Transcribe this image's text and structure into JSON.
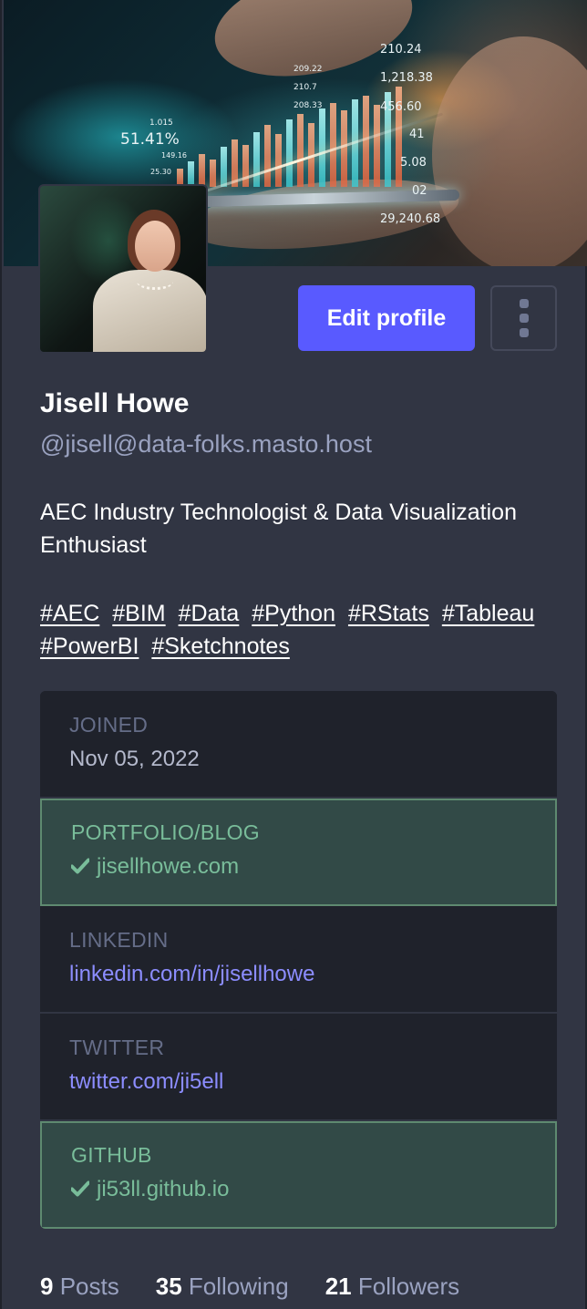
{
  "banner": {
    "numbers": [
      "210.24",
      "1,218.38",
      "456.60",
      "41",
      "5.08",
      "02",
      "29,240.68",
      "51.41%",
      "1.015",
      "209.22",
      "210.7",
      "208.33",
      "149.16",
      "25.30"
    ]
  },
  "profile": {
    "display_name": "Jisell Howe",
    "acct": "@jisell@data-folks.masto.host",
    "bio": "AEC Industry Technologist & Data Visualization Enthusiast",
    "hashtags": [
      "#AEC",
      "#BIM",
      "#Data",
      "#Python",
      "#RStats",
      "#Tableau",
      "#PowerBI",
      "#Sketchnotes"
    ]
  },
  "actions": {
    "edit_label": "Edit profile",
    "more_icon": "vertical-ellipsis-icon"
  },
  "fields": [
    {
      "label": "JOINED",
      "value": "Nov 05, 2022",
      "verified": false,
      "link": false
    },
    {
      "label": "PORTFOLIO/BLOG",
      "value": "jisellhowe.com",
      "verified": true,
      "link": true
    },
    {
      "label": "LINKEDIN",
      "value": "linkedin.com/in/jisellhowe",
      "verified": false,
      "link": true
    },
    {
      "label": "TWITTER",
      "value": "twitter.com/ji5ell",
      "verified": false,
      "link": true
    },
    {
      "label": "GITHUB",
      "value": "ji53ll.github.io",
      "verified": true,
      "link": true
    }
  ],
  "counts": {
    "posts_num": "9",
    "posts_label": "Posts",
    "following_num": "35",
    "following_label": "Following",
    "followers_num": "21",
    "followers_label": "Followers"
  },
  "colors": {
    "accent": "#595aff",
    "background": "#313543",
    "verified": "#79bd9a",
    "link": "#8c8dff"
  }
}
